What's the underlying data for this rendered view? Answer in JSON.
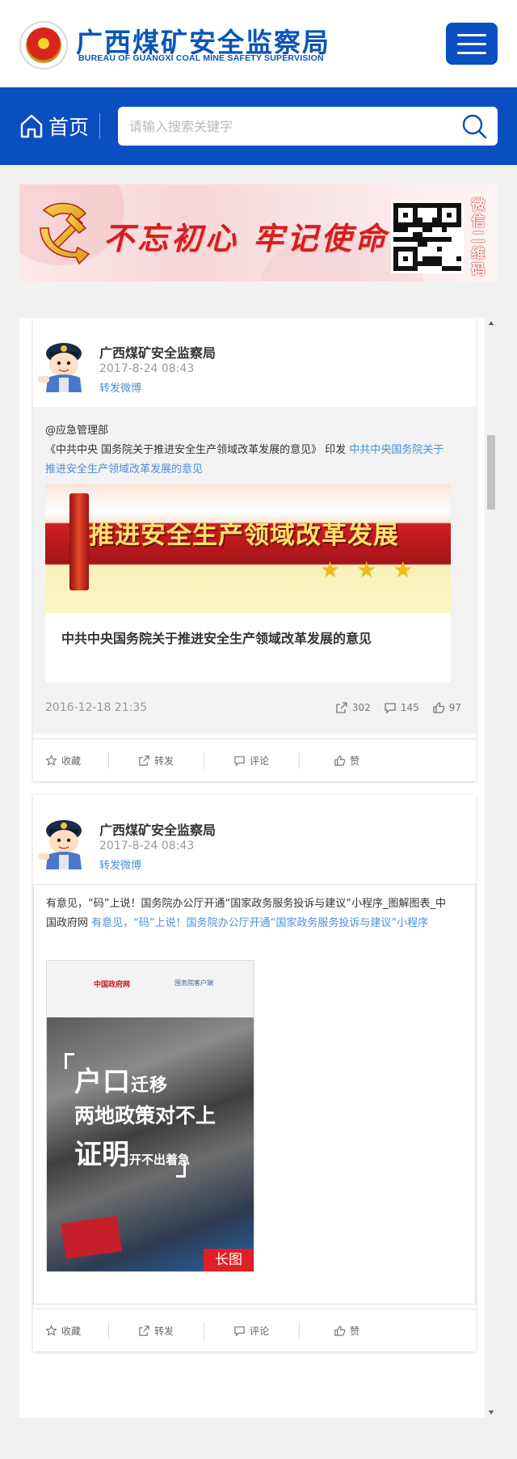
{
  "header": {
    "brand_cn": "广西煤矿安全监察局",
    "brand_en": "BUREAU OF GUANGXI COAL MINE SAFETY SUPERVISION",
    "menu_icon": "hamburger-menu-icon"
  },
  "nav": {
    "home_label": "首页",
    "search_placeholder": "请输入搜索关键字"
  },
  "banner": {
    "slogan": "不忘初心 牢记使命",
    "qr_label": [
      "微",
      "信",
      "二",
      "维",
      "码"
    ]
  },
  "posts": [
    {
      "author": "广西煤矿安全监察局",
      "time": "2017-8-24 08:43",
      "type": "转发微博",
      "mention": "@应急管理部",
      "text": "《中共中央  国务院关于推进安全生产领域改革发展的意见》 印发 ",
      "link_text": "中共中央国务院关于推进安全生产领域改革发展的意见",
      "card_image_headline": "推进安全生产领域改革发展",
      "card_title": "中共中央国务院关于推进安全生产领域改革发展的意见",
      "date": "2016-12-18 21:35",
      "reposts": "302",
      "comments": "145",
      "likes": "97"
    },
    {
      "author": "广西煤矿安全监察局",
      "time": "2017-8-24 08:43",
      "type": "转发微博",
      "text": "有意见，“码”上说！国务院办公厅开通“国家政务服务投诉与建议”小程序_图解图表_中国政府网 ",
      "link_text": "有意见，“码”上说！国务院办公厅开通“国家政务服务投诉与建议”小程序",
      "image_gov": "中国政府网",
      "image_app": "国务院客户端",
      "image_line1": "户口",
      "image_line1_small": "迁移",
      "image_line2": "两地政策对不上",
      "image_line3": "证明",
      "image_line3_small": "开不出着急",
      "image_badge": "长图"
    }
  ],
  "actions": {
    "favorite": "收藏",
    "repost": "转发",
    "comment": "评论",
    "like": "赞"
  },
  "colors": {
    "brand_blue": "#0a4fbf",
    "link_blue": "#4a90d9",
    "slogan_red": "#d41f1f"
  }
}
